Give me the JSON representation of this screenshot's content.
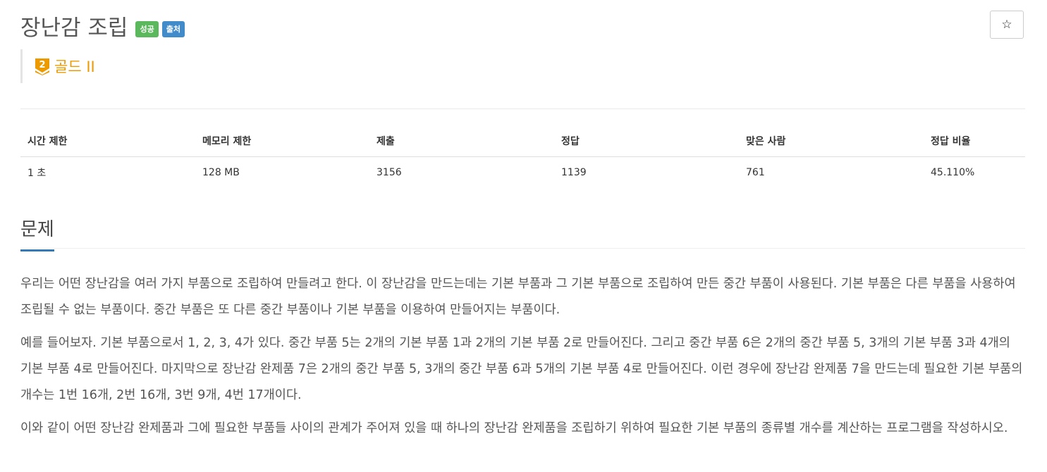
{
  "problem": {
    "title": "장난감 조립",
    "labels": {
      "success": "성공",
      "source": "출처"
    },
    "star": "☆",
    "tier": {
      "number": "2",
      "name": "골드 II",
      "color": "#ec9a00"
    }
  },
  "info_table": {
    "headers": [
      "시간 제한",
      "메모리 제한",
      "제출",
      "정답",
      "맞은 사람",
      "정답 비율"
    ],
    "values": [
      "1 초",
      "128 MB",
      "3156",
      "1139",
      "761",
      "45.110%"
    ]
  },
  "section": {
    "title": "문제",
    "paragraphs": [
      "우리는 어떤 장난감을 여러 가지 부품으로 조립하여 만들려고 한다. 이 장난감을 만드는데는 기본 부품과 그 기본 부품으로 조립하여 만든 중간 부품이 사용된다. 기본 부품은 다른 부품을 사용하여 조립될 수 없는 부품이다. 중간 부품은 또 다른 중간 부품이나 기본 부품을 이용하여 만들어지는 부품이다.",
      "예를 들어보자. 기본 부품으로서 1, 2, 3, 4가 있다. 중간 부품 5는 2개의 기본 부품 1과 2개의 기본 부품 2로 만들어진다. 그리고 중간 부품 6은 2개의 중간 부품 5, 3개의 기본 부품 3과 4개의 기본 부품 4로 만들어진다. 마지막으로 장난감 완제품 7은 2개의 중간 부품 5, 3개의 중간 부품 6과 5개의 기본 부품 4로 만들어진다. 이런 경우에 장난감 완제품 7을 만드는데 필요한 기본 부품의 개수는 1번 16개, 2번 16개, 3번 9개, 4번 17개이다.",
      "이와 같이 어떤 장난감 완제품과 그에 필요한 부품들 사이의 관계가 주어져 있을 때 하나의 장난감 완제품을 조립하기 위하여 필요한 기본 부품의 종류별 개수를 계산하는 프로그램을 작성하시오."
    ]
  },
  "colors": {
    "accent": "#337ab7",
    "success": "#5cb85c",
    "info": "#428bca",
    "gold": "#ec9a00"
  }
}
